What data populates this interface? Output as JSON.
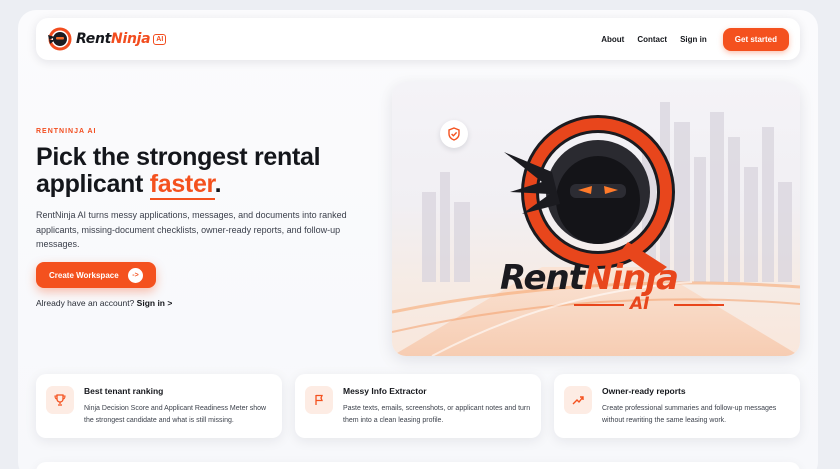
{
  "nav": {
    "brand": {
      "name_part1": "Rent",
      "name_part2": "Ninja",
      "badge": "AI"
    },
    "links": [
      {
        "label": "About"
      },
      {
        "label": "Contact"
      },
      {
        "label": "Sign in"
      }
    ],
    "cta_label": "Get started"
  },
  "hero": {
    "eyebrow": "RENTNINJA AI",
    "headline_part1": "Pick the strongest rental applicant ",
    "headline_accent": "faster",
    "headline_end": ".",
    "subtext": "RentNinja AI turns messy applications, messages, and documents into ranked applicants, missing-document checklists, owner-ready reports, and follow-up messages.",
    "primary_button": {
      "label": "Create Workspace",
      "arrow": "->"
    },
    "signin_prompt": "Already have an account?",
    "signin_link": "Sign in >",
    "image_brand_part1": "Rent",
    "image_brand_part2": "Ninja",
    "image_brand_sub": "AI",
    "shield_icon": "shield-check-icon"
  },
  "features": [
    {
      "icon": "trophy-icon",
      "title": "Best tenant ranking",
      "desc": "Ninja Decision Score and Applicant Readiness Meter show the strongest candidate and what is still missing."
    },
    {
      "icon": "flag-icon",
      "title": "Messy Info Extractor",
      "desc": "Paste texts, emails, screenshots, or applicant notes and turn them into a clean leasing profile."
    },
    {
      "icon": "trend-up-icon",
      "title": "Owner-ready reports",
      "desc": "Create professional summaries and follow-up messages without rewriting the same leasing work."
    }
  ],
  "colors": {
    "accent": "#f4511e",
    "text": "#14161b",
    "icon_bg": "#fdece4"
  }
}
